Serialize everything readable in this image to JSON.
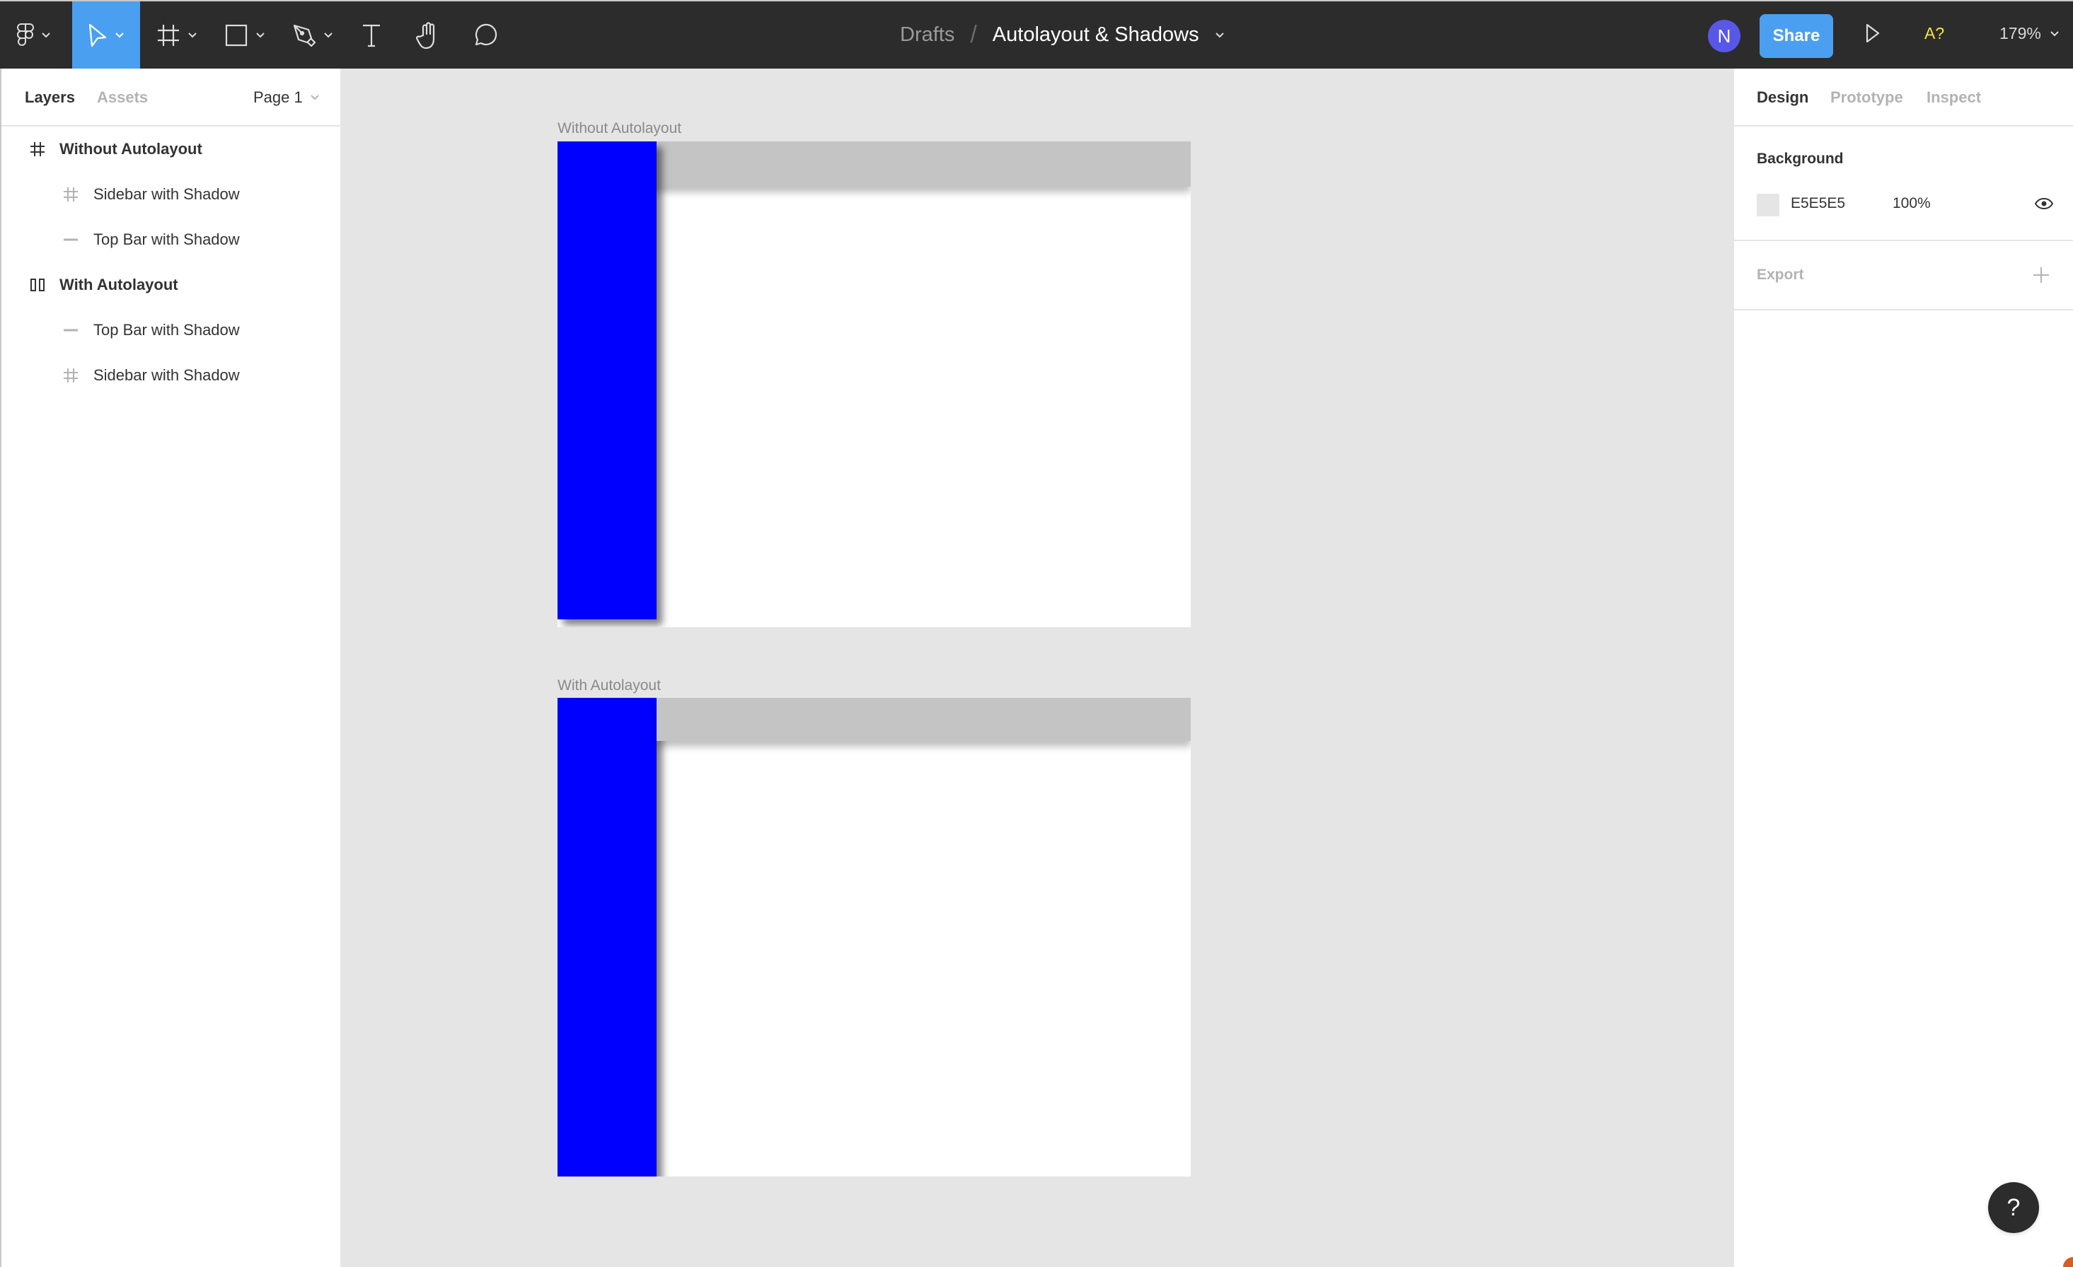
{
  "toolbar": {
    "tools": [
      {
        "name": "main-menu",
        "icon": "figma-logo-icon",
        "has_dropdown": true,
        "active": false
      },
      {
        "name": "move",
        "icon": "cursor-arrow-icon",
        "has_dropdown": true,
        "active": true
      },
      {
        "name": "frame",
        "icon": "frame-hash-icon",
        "has_dropdown": true,
        "active": false
      },
      {
        "name": "shape",
        "icon": "rectangle-icon",
        "has_dropdown": true,
        "active": false
      },
      {
        "name": "pen",
        "icon": "pen-icon",
        "has_dropdown": true,
        "active": false
      },
      {
        "name": "text",
        "icon": "text-icon",
        "has_dropdown": false,
        "active": false
      },
      {
        "name": "hand",
        "icon": "hand-icon",
        "has_dropdown": false,
        "active": false
      },
      {
        "name": "comment",
        "icon": "comment-icon",
        "has_dropdown": false,
        "active": false
      }
    ],
    "breadcrumb": "Drafts",
    "separator": "/",
    "file_name": "Autolayout & Shadows",
    "avatar_initial": "N",
    "share_label": "Share",
    "a11y_label": "A?",
    "zoom_level": "179%"
  },
  "left_panel": {
    "tabs": [
      "Layers",
      "Assets"
    ],
    "active_tab": "Layers",
    "page_selector": "Page 1",
    "layers": [
      {
        "label": "Without Autolayout",
        "level": 0,
        "icon": "frame-icon"
      },
      {
        "label": "Sidebar with Shadow",
        "level": 1,
        "icon": "frame-icon"
      },
      {
        "label": "Top Bar with Shadow",
        "level": 1,
        "icon": "line-icon"
      },
      {
        "label": "With Autolayout",
        "level": 0,
        "icon": "autolayout-icon"
      },
      {
        "label": "Top Bar with Shadow",
        "level": 1,
        "icon": "line-icon"
      },
      {
        "label": "Sidebar with Shadow",
        "level": 1,
        "icon": "frame-icon"
      }
    ]
  },
  "canvas": {
    "background": "#E5E5E5",
    "frames": [
      {
        "label": "Without Autolayout",
        "sidebar_color": "#0000FF",
        "topbar_color": "#C4C4C4",
        "sidebar_on_top": true
      },
      {
        "label": "With Autolayout",
        "sidebar_color": "#0000FF",
        "topbar_color": "#C4C4C4",
        "sidebar_on_top": false
      }
    ]
  },
  "right_panel": {
    "tabs": [
      "Design",
      "Prototype",
      "Inspect"
    ],
    "active_tab": "Design",
    "background_section": {
      "title": "Background",
      "hex": "E5E5E5",
      "opacity": "100%"
    },
    "export_section": {
      "title": "Export"
    }
  },
  "help_label": "?",
  "colors": {
    "accent": "#4B9FF0",
    "avatar": "#5957E8",
    "toolbar_bg": "#2C2C2C",
    "a11y": "#F4E53C"
  }
}
